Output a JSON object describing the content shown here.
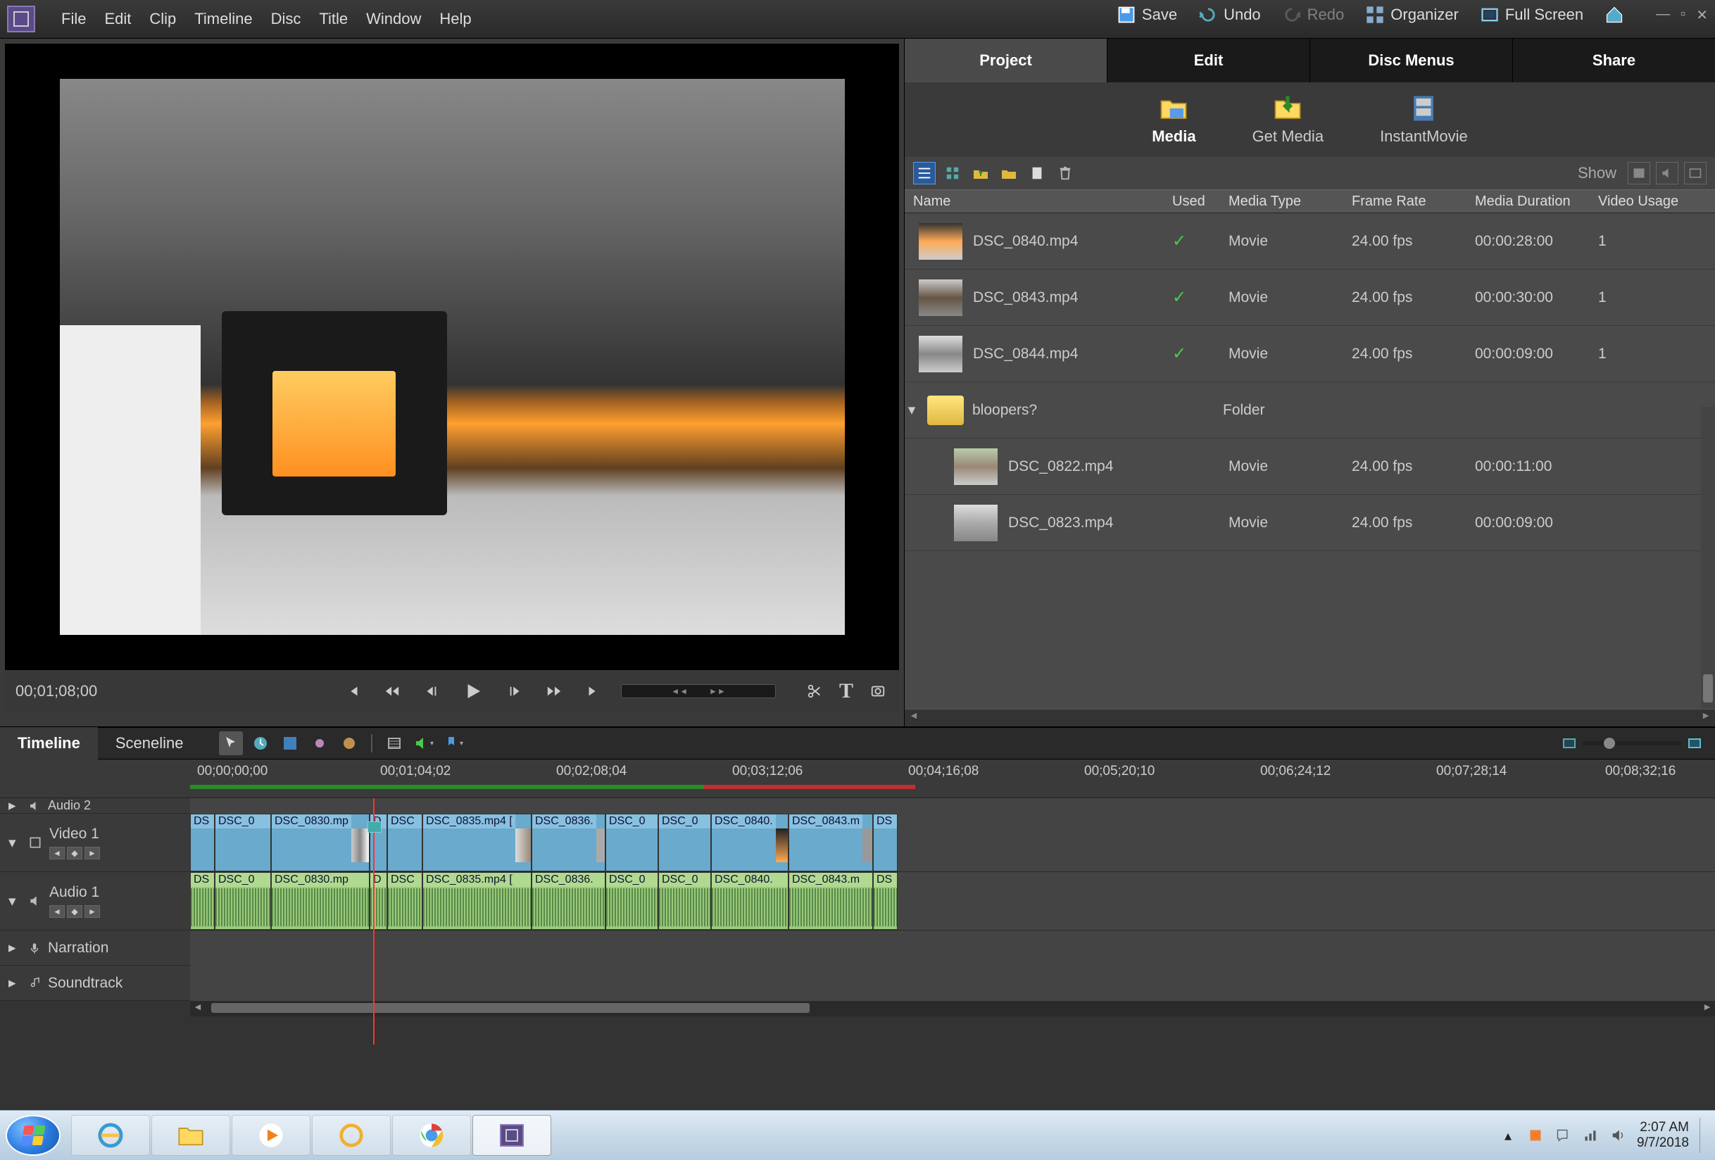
{
  "menu": {
    "file": "File",
    "edit": "Edit",
    "clip": "Clip",
    "timeline": "Timeline",
    "disc": "Disc",
    "title": "Title",
    "window": "Window",
    "help": "Help"
  },
  "top": {
    "save": "Save",
    "undo": "Undo",
    "redo": "Redo",
    "organizer": "Organizer",
    "fullscreen": "Full Screen"
  },
  "monitor": {
    "timecode": "00;01;08;00"
  },
  "panelTabs": {
    "project": "Project",
    "edit": "Edit",
    "disc": "Disc Menus",
    "share": "Share"
  },
  "subtabs": {
    "media": "Media",
    "getmedia": "Get Media",
    "instant": "InstantMovie"
  },
  "mediaToolbar": {
    "show": "Show"
  },
  "mediaCols": {
    "name": "Name",
    "used": "Used",
    "type": "Media Type",
    "rate": "Frame Rate",
    "dur": "Media Duration",
    "usage": "Video Usage"
  },
  "mediaRows": [
    {
      "name": "DSC_0840.mp4",
      "used": "✓",
      "type": "Movie",
      "rate": "24.00 fps",
      "dur": "00:00:28:00",
      "usage": "1"
    },
    {
      "name": "DSC_0843.mp4",
      "used": "✓",
      "type": "Movie",
      "rate": "24.00 fps",
      "dur": "00:00:30:00",
      "usage": "1"
    },
    {
      "name": "DSC_0844.mp4",
      "used": "✓",
      "type": "Movie",
      "rate": "24.00 fps",
      "dur": "00:00:09:00",
      "usage": "1"
    }
  ],
  "folder": {
    "name": "bloopers?",
    "type": "Folder"
  },
  "folderRows": [
    {
      "name": "DSC_0822.mp4",
      "type": "Movie",
      "rate": "24.00 fps",
      "dur": "00:00:11:00"
    },
    {
      "name": "DSC_0823.mp4",
      "type": "Movie",
      "rate": "24.00 fps",
      "dur": "00:00:09:00"
    }
  ],
  "tlTabs": {
    "timeline": "Timeline",
    "sceneline": "Sceneline"
  },
  "ruler": {
    "t0": "00;00;00;00",
    "t1": "00;01;04;02",
    "t2": "00;02;08;04",
    "t3": "00;03;12;06",
    "t4": "00;04;16;08",
    "t5": "00;05;20;10",
    "t6": "00;06;24;12",
    "t7": "00;07;28;14",
    "t8": "00;08;32;16"
  },
  "tracks": {
    "audio2": "Audio 2",
    "video1": "Video 1",
    "audio1": "Audio 1",
    "narration": "Narration",
    "soundtrack": "Soundtrack"
  },
  "clips": {
    "ds": "DS",
    "c1": "DSC_0",
    "c2": "DSC_0830.mp",
    "c3": "D",
    "c4": "DSC",
    "c5": "DSC_0835.mp4 [",
    "c6": "DSC_0836.",
    "c7": "DSC_0",
    "c8": "DSC_0",
    "c9": "DSC_0840.",
    "c10": "DSC_0843.m"
  },
  "tray": {
    "time": "2:07 AM",
    "date": "9/7/2018"
  }
}
